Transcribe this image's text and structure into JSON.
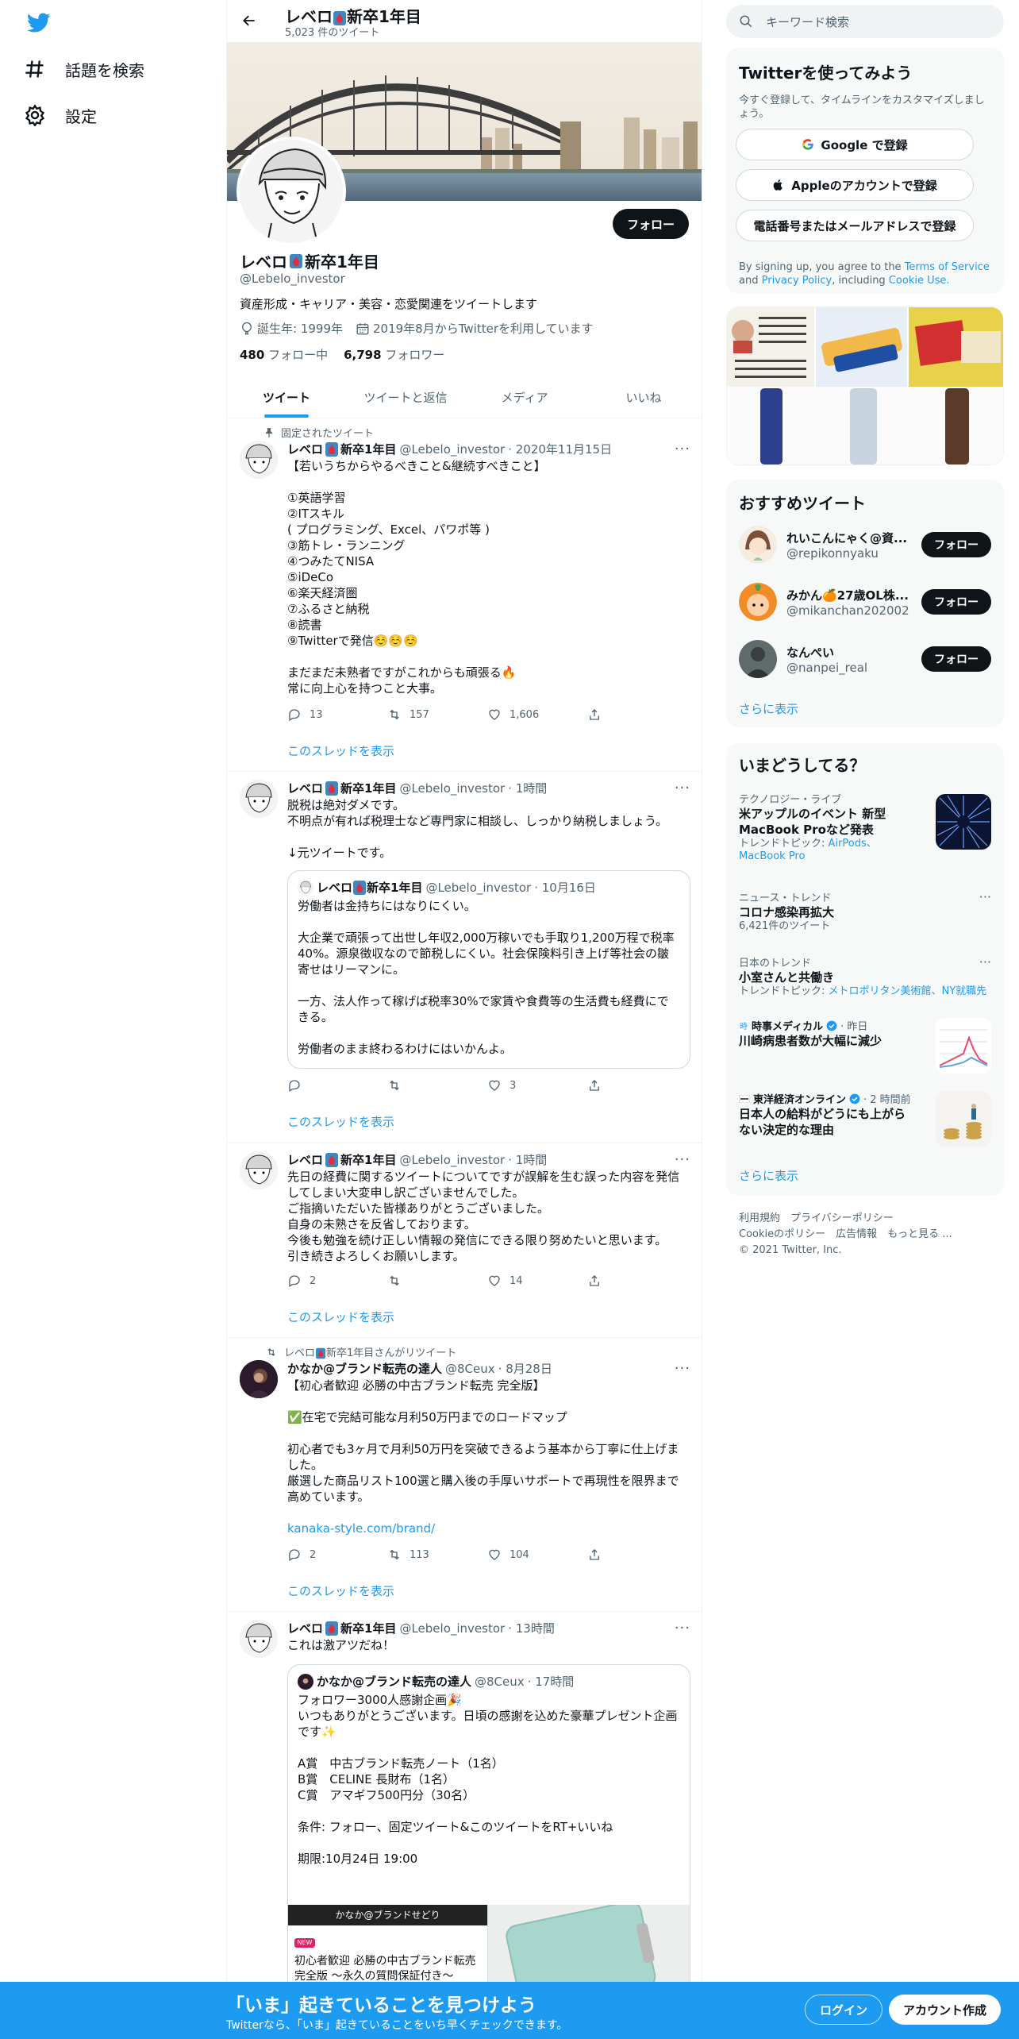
{
  "nav": {
    "explore_label": "話題を検索",
    "settings_label": "設定"
  },
  "profile": {
    "name": "レベロ",
    "name_suffix": "新卒1年目",
    "tweet_count": "5,023 件のツイート",
    "handle": "@Lebelo_investor",
    "follow_label": "フォロー",
    "bio": "資産形成・キャリア・美容・恋愛関連をツイートします",
    "birth": "誕生年: 1999年",
    "joined": "2019年8月からTwitterを利用しています",
    "following_count": "480",
    "following_label": "フォロー中",
    "followers_count": "6,798",
    "followers_label": "フォロワー"
  },
  "tabs": [
    "ツイート",
    "ツイートと返信",
    "メディア",
    "いいね"
  ],
  "tweets": [
    {
      "social": "固定されたツイート",
      "name": "レベロ",
      "suffix": "新卒1年目",
      "handle": "@Lebelo_investor",
      "time": "· 2020年11月15日",
      "body": "【若いうちからやるべきこと&継続すべきこと】\n\n①英語学習\n②ITスキル\n( プログラミング、Excel、パワポ等 )\n③筋トレ・ランニング\n④つみたてNISA\n⑤iDeCo\n⑥楽天経済圏\n⑦ふるさと納税\n⑧読書\n⑨Twitterで発信☺️☺️☺️",
      "body2": "まだまだ未熟者ですがこれからも頑張る🔥\n常に向上心を持つこと大事。",
      "reply": "13",
      "rt": "157",
      "like": "1,606",
      "thread": "このスレッドを表示"
    },
    {
      "name": "レベロ",
      "suffix": "新卒1年目",
      "handle": "@Lebelo_investor",
      "time": "· 1時間",
      "body": "脱税は絶対ダメです。\n不明点が有れば税理士など専門家に相談し、しっかり納税しましょう。\n\n↓元ツイートです。",
      "quote": {
        "name": "レベロ",
        "suffix": "新卒1年目",
        "handle": "@Lebelo_investor",
        "time": "· 10月16日",
        "body": "労働者は金持ちにはなりにくい。\n\n大企業で頑張って出世し年収2,000万稼いでも手取り1,200万程で税率40%。源泉徴収なので節税しにくい。社会保険料引き上げ等社会の皺寄せはリーマンに。\n\n一方、法人作って稼げば税率30%で家賃や食費等の生活費も経費にできる。\n\n労働者のまま終わるわけにはいかんよ。"
      },
      "reply": "",
      "rt": "",
      "like": "3",
      "thread": "このスレッドを表示"
    },
    {
      "name": "レベロ",
      "suffix": "新卒1年目",
      "handle": "@Lebelo_investor",
      "time": "· 1時間",
      "body": "先日の経費に関するツイートについてですが誤解を生む誤った内容を発信してしまい大変申し訳ございませんでした。\nご指摘いただいた皆様ありがとうございました。\n自身の未熟さを反省しております。\n今後も勉強を続け正しい情報の発信にできる限り努めたいと思います。\n引き続きよろしくお願いします。",
      "reply": "2",
      "rt": "",
      "like": "14",
      "thread": "このスレッドを表示"
    },
    {
      "social_prefix": "レベロ",
      "social_suffix": "新卒1年目さんがリツイート",
      "name": "かなか@ブランド転売の達人",
      "handle": "@8Ceux",
      "time": "· 8月28日",
      "body": "【初心者歓迎 必勝の中古ブランド転売 完全版】\n\n✅在宅で完結可能な月利50万円までのロードマップ\n\n初心者でも3ヶ月で月利50万円を突破できるよう基本から丁寧に仕上げました。\n厳選した商品リスト100選と購入後の手厚いサポートで再現性を限界まで高めています。",
      "link": "kanaka-style.com/brand/",
      "reply": "2",
      "rt": "113",
      "like": "104",
      "thread": "このスレッドを表示"
    },
    {
      "name": "レベロ",
      "suffix": "新卒1年目",
      "handle": "@Lebelo_investor",
      "time": "· 13時間",
      "body": "これは激アツだね！",
      "quote": {
        "name": "かなか@ブランド転売の達人",
        "handle": "@8Ceux",
        "time": "· 17時間",
        "body": "フォロワー3000人感謝企画🎉\nいつもありがとうございます。日頃の感謝を込めた豪華プレゼント企画です✨\n\nA賞　中古ブランド転売ノート（1名）\nB賞　CELINE 長財布（1名）\nC賞　アマギフ500円分（30名）\n\n条件: フォロー、固定ツイート&このツイートをRT+いいね\n\n期限:10月24日 19:00",
        "card_header": "かなか@ブランドせどり",
        "card_badge": "NEW",
        "card_text": "初心者歓迎 必勝の中古ブランド転売 完全版 〜永久の質問保証付き〜"
      }
    }
  ],
  "right": {
    "search_placeholder": "キーワード検索",
    "signup": {
      "title": "Twitterを使ってみよう",
      "sub": "今すぐ登録して、タイムラインをカスタマイズしましょう。",
      "google": "Google で登録",
      "apple": "Appleのアカウントで登録",
      "phone": "電話番号またはメールアドレスで登録",
      "legal_pre": "By signing up, you agree to the",
      "tos": "Terms of Service",
      "and": "and",
      "privacy": "Privacy Policy",
      "including": ", including",
      "cookie": "Cookie Use."
    },
    "recommend": {
      "title": "おすすめツイート",
      "users": [
        {
          "name": "れいこんにゃく@資...",
          "handle": "@repikonnyaku",
          "btn": "フォロー"
        },
        {
          "name": "みかん🍊27歳OL株...",
          "handle": "@mikanchan202002",
          "btn": "フォロー"
        },
        {
          "name": "なんぺい",
          "handle": "@nanpei_real",
          "btn": "フォロー"
        }
      ],
      "more": "さらに表示"
    },
    "trends": {
      "title": "いまどうしてる？",
      "items": [
        {
          "cat": "テクノロジー・ライブ",
          "title": "米アップルのイベント 新型MacBook Proなど発表",
          "sub_pre": "トレンドトピック: ",
          "sub_links": "AirPods、MacBook Pro"
        },
        {
          "cat": "ニュース・トレンド",
          "title": "コロナ感染再拡大",
          "sub": "6,421件のツイート"
        },
        {
          "cat": "日本のトレンド",
          "title": "小室さんと共働き",
          "sub_pre": "トレンドトピック: ",
          "sub_links": "メトロポリタン美術館、NY就職先"
        },
        {
          "cat_name": "時事メディカル",
          "cat_time": "· 昨日",
          "title": "川崎病患者数が大幅に減少"
        },
        {
          "cat_name": "東洋経済オンライン",
          "cat_time": "· 2 時間前",
          "title": "日本人の給料がどうにも上がらない決定的な理由"
        }
      ],
      "more": "さらに表示"
    },
    "footer": {
      "line1": "利用規約　プライバシーポリシー",
      "line2": "Cookieのポリシー　広告情報　もっと見る ...",
      "line3": "© 2021 Twitter, Inc."
    }
  },
  "bottom": {
    "title": "「いま」起きていることを見つけよう",
    "sub": "Twitterなら、「いま」起きていることをいち早くチェックできます。",
    "login": "ログイン",
    "signup": "アカウント作成"
  },
  "colors": {
    "accent": "#1d9bf0",
    "text": "#0f1419",
    "muted": "#536471"
  }
}
